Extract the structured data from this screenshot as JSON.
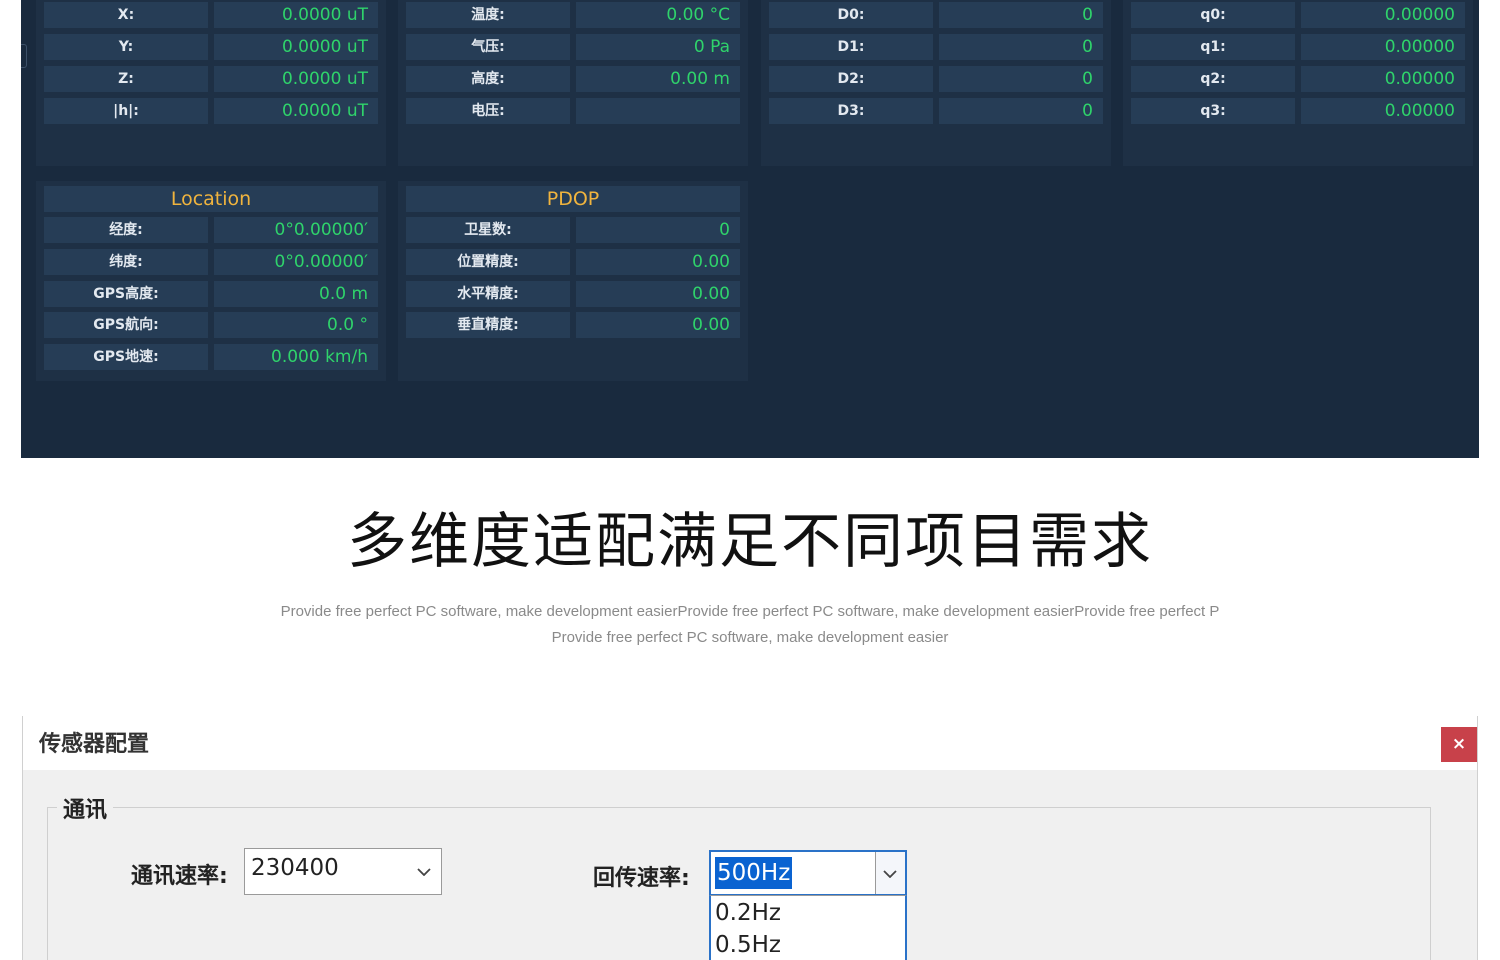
{
  "dashboard": {
    "magnetometer": [
      {
        "label": "X:",
        "value": "0.0000 uT"
      },
      {
        "label": "Y:",
        "value": "0.0000 uT"
      },
      {
        "label": "Z:",
        "value": "0.0000 uT"
      },
      {
        "label": "|h|:",
        "value": "0.0000 uT"
      }
    ],
    "environment": [
      {
        "label": "温度:",
        "value": "0.00 °C"
      },
      {
        "label": "气压:",
        "value": "0 Pa"
      },
      {
        "label": "高度:",
        "value": "0.00 m"
      },
      {
        "label": "电压:",
        "value": ""
      }
    ],
    "ports": [
      {
        "label": "D0:",
        "value": "0"
      },
      {
        "label": "D1:",
        "value": "0"
      },
      {
        "label": "D2:",
        "value": "0"
      },
      {
        "label": "D3:",
        "value": "0"
      }
    ],
    "quaternion": [
      {
        "label": "q0:",
        "value": "0.00000"
      },
      {
        "label": "q1:",
        "value": "0.00000"
      },
      {
        "label": "q2:",
        "value": "0.00000"
      },
      {
        "label": "q3:",
        "value": "0.00000"
      }
    ],
    "location": {
      "title": "Location",
      "rows": [
        {
          "label": "经度:",
          "value": "0°0.00000′"
        },
        {
          "label": "纬度:",
          "value": "0°0.00000′"
        },
        {
          "label": "GPS高度:",
          "value": "0.0 m"
        },
        {
          "label": "GPS航向:",
          "value": "0.0 °"
        },
        {
          "label": "GPS地速:",
          "value": "0.000 km/h"
        }
      ]
    },
    "pdop": {
      "title": "PDOP",
      "rows": [
        {
          "label": "卫星数:",
          "value": "0"
        },
        {
          "label": "位置精度:",
          "value": "0.00"
        },
        {
          "label": "水平精度:",
          "value": "0.00"
        },
        {
          "label": "垂直精度:",
          "value": "0.00"
        }
      ]
    }
  },
  "slogan": {
    "title": "多维度适配满足不同项目需求",
    "subtitle_line1": "Provide free perfect PC software, make development easierProvide free perfect PC software, make development easierProvide free perfect P",
    "subtitle_line2": "Provide free perfect PC software, make development easier"
  },
  "dialog": {
    "title": "传感器配置",
    "close_label": "×",
    "group_title": "通讯",
    "baud_label": "通讯速率:",
    "baud_value": "230400",
    "rate_label": "回传速率:",
    "rate_value": "500Hz",
    "rate_options": [
      "0.2Hz",
      "0.5Hz"
    ]
  },
  "colors": {
    "dashboard_bg": "#192a3e",
    "value_green": "#2fd36b",
    "header_gold": "#f0b43e",
    "close_red": "#c8414a",
    "selection_blue": "#0a63d1"
  }
}
